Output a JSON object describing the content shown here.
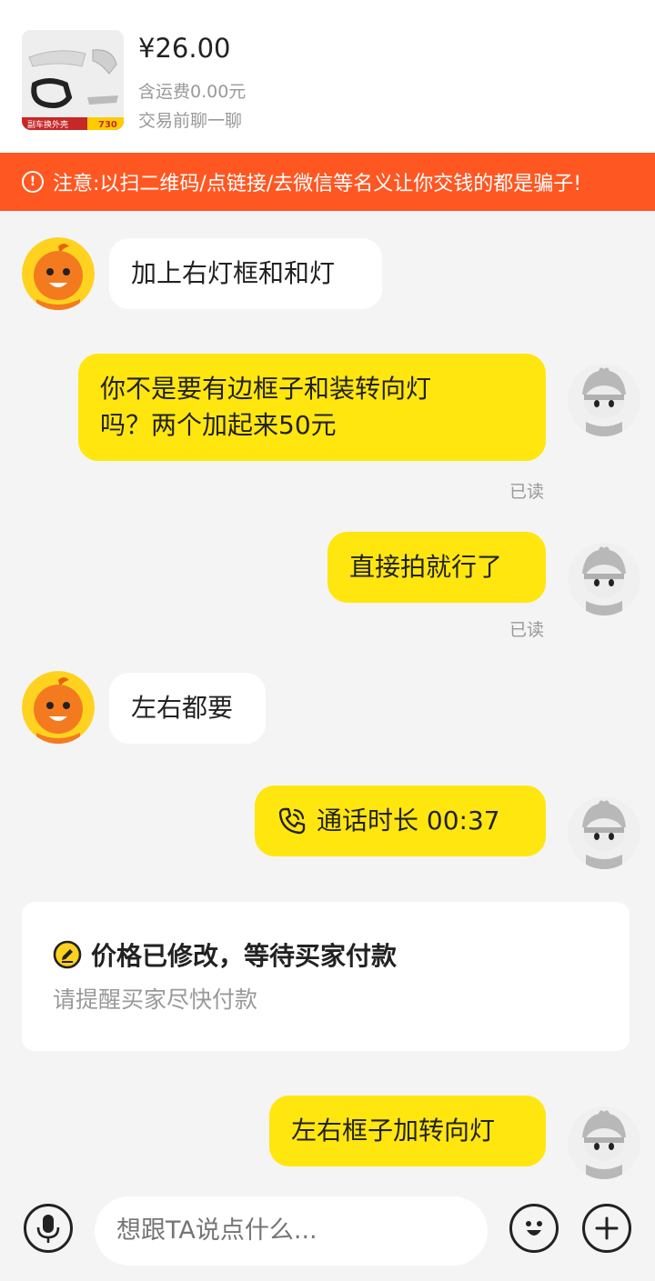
{
  "product": {
    "price": "¥26.00",
    "shipping": "含运费0.00元",
    "note": "交易前聊一聊",
    "thumb_tag_left": "副车换外壳",
    "thumb_tag_right": "730"
  },
  "warning": {
    "icon": "!",
    "text": "注意:以扫二维码/点链接/去微信等名义让你交钱的都是骗子!"
  },
  "messages": {
    "m1": "加上右灯框和和灯",
    "m2_line1": "你不是要有边框子和装转向灯",
    "m2_line2": "吗？两个加起来50元",
    "m2_status": "已读",
    "m3": "直接拍就行了",
    "m3_status": "已读",
    "m4": "左右都要",
    "m5": "通话时长 00:37",
    "m6": "左右框子加转向灯"
  },
  "price_card": {
    "title": "价格已修改，等待买家付款",
    "subtitle": "请提醒买家尽快付款"
  },
  "input": {
    "placeholder": "想跟TA说点什么..."
  },
  "colors": {
    "warning_bg": "#ff5722",
    "self_bubble": "#ffe60f",
    "other_bubble": "#ffffff",
    "background": "#f4f4f4"
  }
}
